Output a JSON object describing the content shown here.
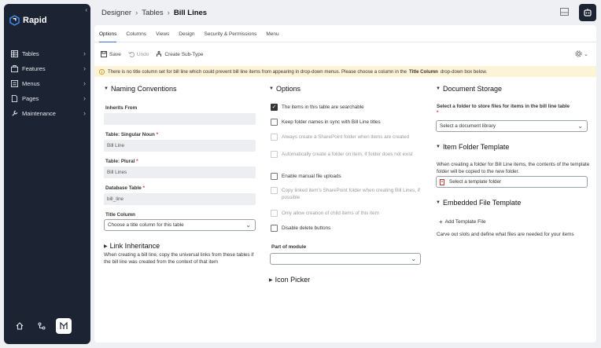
{
  "app": {
    "name": "Rapid"
  },
  "sidebar": {
    "items": [
      {
        "label": "Tables"
      },
      {
        "label": "Features"
      },
      {
        "label": "Menus"
      },
      {
        "label": "Pages"
      },
      {
        "label": "Maintenance"
      }
    ]
  },
  "breadcrumb": [
    "Designer",
    "Tables",
    "Bill Lines"
  ],
  "tabs": [
    "Options",
    "Columns",
    "Views",
    "Design",
    "Security & Permissions",
    "Menu"
  ],
  "toolbar": {
    "save": "Save",
    "undo": "Undo",
    "create_subtype": "Create Sub-Type"
  },
  "warning": {
    "prefix": "There is no title column set for bill line which could prevent bill line items from appearing in drop-down menus. Please choose a column in the",
    "strong": "Title Column",
    "suffix": "drop-down box below."
  },
  "naming": {
    "title": "Naming Conventions",
    "inherits_from_label": "Inherits From",
    "inherits_from_value": "",
    "singular_label": "Table: Singular Noun",
    "singular_value": "Bill Line",
    "plural_label": "Table: Plural",
    "plural_value": "Bill Lines",
    "db_label": "Database Table",
    "db_value": "bill_line",
    "title_col_label": "Title Column",
    "title_col_value": "Choose a title column for this table",
    "required_mark": "*"
  },
  "link_inheritance": {
    "title": "Link Inheritance",
    "description": "When creating a bill line, copy the universal links from these tables if the bill line was created from the context of that item"
  },
  "options": {
    "title": "Options",
    "items": [
      {
        "label": "The items in this table are searchable",
        "checked": true,
        "disabled": false
      },
      {
        "label": "Keep folder names in sync with Bill Line titles",
        "checked": false,
        "disabled": false
      },
      {
        "label": "Always create a SharePoint folder when items are created",
        "checked": false,
        "disabled": true
      },
      {
        "label": "Automatically create a folder on item, if folder does not exist",
        "checked": false,
        "disabled": true
      },
      {
        "label": "Enable manual file uploads",
        "checked": false,
        "disabled": false
      },
      {
        "label": "Copy linked item's SharePoint folder when creating Bill Lines, if possible",
        "checked": false,
        "disabled": true
      },
      {
        "label": "Only allow creation of child items of this item",
        "checked": false,
        "disabled": true
      },
      {
        "label": "Disable delete buttons",
        "checked": false,
        "disabled": false
      }
    ],
    "part_of_module_label": "Part of module",
    "part_of_module_value": ""
  },
  "icon_picker": {
    "title": "Icon Picker"
  },
  "document_storage": {
    "title": "Document Storage",
    "description": "Select a folder to store files for items in the bill line table",
    "required_mark": "*",
    "select_placeholder": "Select a document library"
  },
  "item_folder": {
    "title": "Item Folder Template",
    "description": "When creating a folder for Bill Line items, the contents of the template folder will be copied to the new folder.",
    "select_placeholder": "Select a template folder"
  },
  "embedded_file": {
    "title": "Embedded File Template",
    "add_label": "Add Template File",
    "description": "Carve out slots and define what files are needed for your items"
  },
  "colors": {
    "sidebar": "#1c2333",
    "accent": "#3a6ee8",
    "warning_bg": "#fdf3d7"
  }
}
